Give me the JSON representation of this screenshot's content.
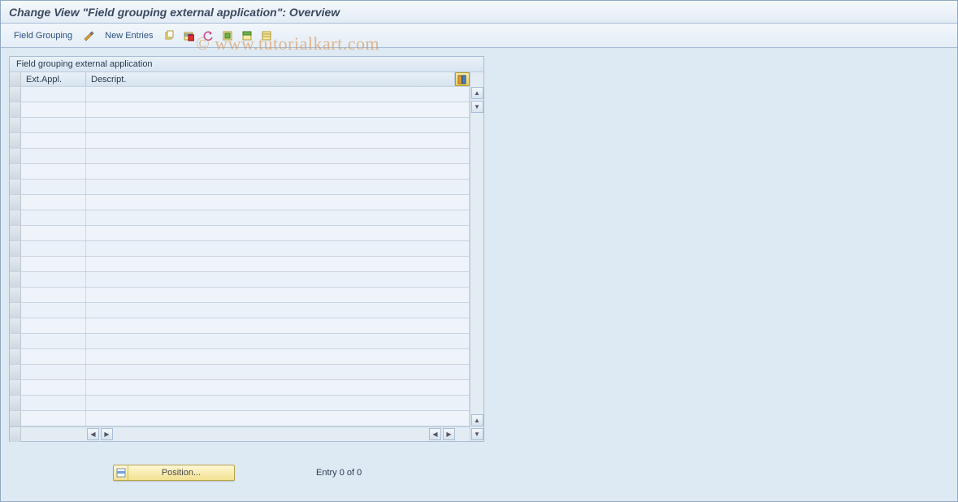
{
  "header": {
    "title": "Change View \"Field grouping external application\": Overview"
  },
  "toolbar": {
    "field_grouping_label": "Field Grouping",
    "new_entries_label": "New Entries"
  },
  "panel": {
    "title": "Field grouping external application",
    "columns": {
      "col1": "Ext.Appl.",
      "col2": "Descript."
    },
    "rows": [
      {
        "ext_appl": "",
        "descript": ""
      },
      {
        "ext_appl": "",
        "descript": ""
      },
      {
        "ext_appl": "",
        "descript": ""
      },
      {
        "ext_appl": "",
        "descript": ""
      },
      {
        "ext_appl": "",
        "descript": ""
      },
      {
        "ext_appl": "",
        "descript": ""
      },
      {
        "ext_appl": "",
        "descript": ""
      },
      {
        "ext_appl": "",
        "descript": ""
      },
      {
        "ext_appl": "",
        "descript": ""
      },
      {
        "ext_appl": "",
        "descript": ""
      },
      {
        "ext_appl": "",
        "descript": ""
      },
      {
        "ext_appl": "",
        "descript": ""
      },
      {
        "ext_appl": "",
        "descript": ""
      },
      {
        "ext_appl": "",
        "descript": ""
      },
      {
        "ext_appl": "",
        "descript": ""
      },
      {
        "ext_appl": "",
        "descript": ""
      },
      {
        "ext_appl": "",
        "descript": ""
      },
      {
        "ext_appl": "",
        "descript": ""
      },
      {
        "ext_appl": "",
        "descript": ""
      },
      {
        "ext_appl": "",
        "descript": ""
      },
      {
        "ext_appl": "",
        "descript": ""
      },
      {
        "ext_appl": "",
        "descript": ""
      }
    ]
  },
  "footer": {
    "position_label": "Position...",
    "entry_status": "Entry 0 of 0"
  },
  "watermark": "© www.tutorialkart.com"
}
